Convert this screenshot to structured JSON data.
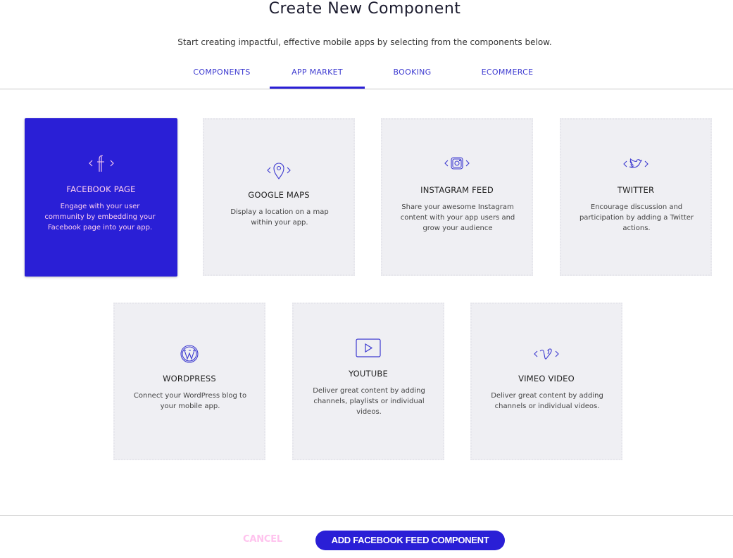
{
  "header": {
    "title": "Create New Component",
    "subtitle": "Start creating impactful, effective mobile apps by selecting from the components below."
  },
  "tabs": [
    {
      "label": "COMPONENTS",
      "active": false
    },
    {
      "label": "APP MARKET",
      "active": true
    },
    {
      "label": "BOOKING",
      "active": false
    },
    {
      "label": "ECOMMERCE",
      "active": false
    }
  ],
  "cards": [
    {
      "title": "FACEBOOK PAGE",
      "description": "Engage with your user community by embedding your Facebook page into your app.",
      "icon": "facebook-icon",
      "selected": true
    },
    {
      "title": "GOOGLE MAPS",
      "description": "Display a location on a map within your app.",
      "icon": "map-pin-icon",
      "selected": false
    },
    {
      "title": "INSTAGRAM FEED",
      "description": "Share your awesome Instagram content with your app users and grow your audience",
      "icon": "instagram-icon",
      "selected": false
    },
    {
      "title": "TWITTER",
      "description": "Encourage discussion and participation by adding a Twitter actions.",
      "icon": "twitter-icon",
      "selected": false
    },
    {
      "title": "WORDPRESS",
      "description": "Connect your WordPress blog to your mobile app.",
      "icon": "wordpress-icon",
      "selected": false
    },
    {
      "title": "YOUTUBE",
      "description": "Deliver great content by adding channels, playlists or individual videos.",
      "icon": "youtube-icon",
      "selected": false
    },
    {
      "title": "VIMEO VIDEO",
      "description": "Deliver great content by adding channels or individual videos.",
      "icon": "vimeo-icon",
      "selected": false
    }
  ],
  "footer": {
    "cancel_label": "CANCEL",
    "primary_label": "ADD FACEBOOK FEED COMPONENT"
  },
  "colors": {
    "accent": "#2a1fd6",
    "selected_text": "#ffd0f0",
    "cancel_text": "#ffc3ee",
    "card_bg": "#efeff3"
  }
}
